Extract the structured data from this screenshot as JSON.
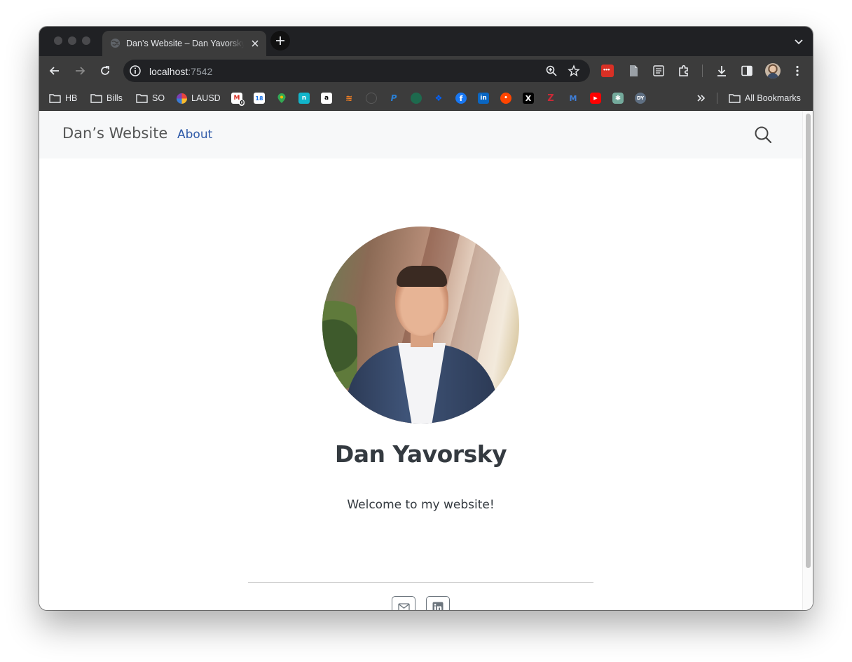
{
  "browser": {
    "tab": {
      "title": "Dan’s Website – Dan Yavorsky"
    },
    "url": {
      "host": "localhost",
      "port": ":7542"
    },
    "bookmarks": {
      "folders": [
        "HB",
        "Bills",
        "SO"
      ],
      "lausd": "LAUSD",
      "icons": [
        "gmail-icon",
        "calendar-icon",
        "maps-icon",
        "notion-icon",
        "amazon-icon",
        "stackoverflow-icon",
        "github-icon",
        "paypal-icon",
        "starbucks-icon",
        "dropbox-icon",
        "facebook-icon",
        "linkedin-icon",
        "reddit-icon",
        "x-icon",
        "zotero-icon",
        "mendeley-icon",
        "youtube-icon",
        "chatgpt-icon",
        "dy-icon"
      ],
      "gmail_badge": "0",
      "calendar_day": "18",
      "dy_label": "DY",
      "all_bookmarks": "All Bookmarks"
    }
  },
  "site": {
    "brand": "Dan’s Website",
    "nav": {
      "about": "About"
    },
    "name": "Dan Yavorsky",
    "welcome": "Welcome to my website!",
    "social": [
      "email-icon",
      "linkedin-icon"
    ]
  },
  "colors": {
    "link": "#2f5aa8",
    "navbar_bg": "#f7f8f9",
    "heading": "#343a40"
  }
}
